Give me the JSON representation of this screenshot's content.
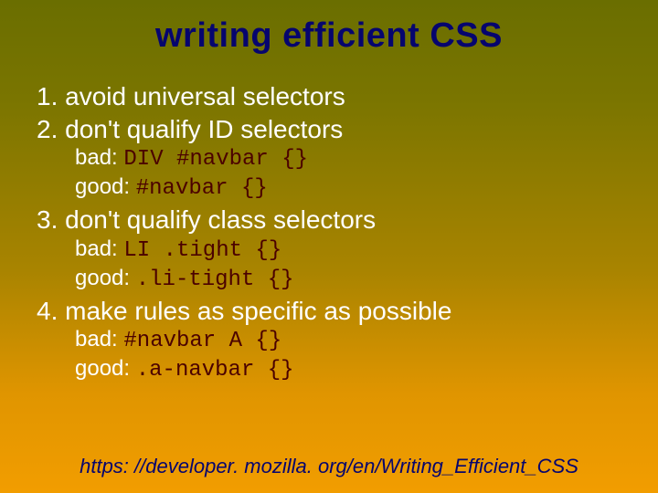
{
  "title": "writing efficient CSS",
  "rules": [
    {
      "num": "1.",
      "text": "avoid universal selectors"
    },
    {
      "num": "2.",
      "text": "don't qualify ID selectors",
      "bad_label": "bad: ",
      "bad_code": "DIV #navbar {}",
      "good_label": "good: ",
      "good_code": "#navbar {}"
    },
    {
      "num": "3.",
      "text": "don't qualify class selectors",
      "bad_label": "bad: ",
      "bad_code": "LI .tight {}",
      "good_label": "good: ",
      "good_code": ".li-tight {}"
    },
    {
      "num": "4.",
      "text": "make rules as specific as possible",
      "bad_label": "bad: ",
      "bad_code": "#navbar A {}",
      "good_label": "good: ",
      "good_code": ".a-navbar {}"
    }
  ],
  "footer": "https: //developer. mozilla. org/en/Writing_Efficient_CSS"
}
